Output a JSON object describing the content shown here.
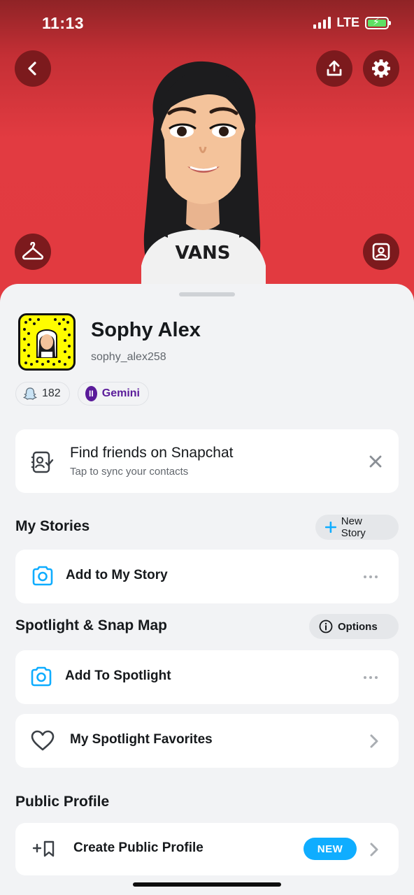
{
  "status_bar": {
    "time": "11:13",
    "network": "LTE"
  },
  "header": {
    "back_icon": "chevron-left-icon",
    "share_icon": "share-upload-icon",
    "settings_icon": "gear-icon",
    "wardrobe_icon": "hanger-icon",
    "selfie_icon": "image-icon",
    "avatar_shirt_text": "VANS",
    "accent_color": "#e23a40"
  },
  "profile": {
    "display_name": "Sophy Alex",
    "username": "sophy_alex258",
    "snap_score": "182",
    "zodiac_label": "Gemini"
  },
  "find_friends": {
    "title": "Find friends on Snapchat",
    "subtitle": "Tap to sync your contacts"
  },
  "my_stories": {
    "title": "My Stories",
    "new_story_label": "New Story",
    "add_label": "Add to My Story"
  },
  "spotlight": {
    "title": "Spotlight & Snap Map",
    "options_label": "Options",
    "add_label": "Add To Spotlight",
    "favorites_label": "My Spotlight Favorites"
  },
  "public_profile": {
    "title": "Public Profile",
    "create_label": "Create Public Profile",
    "badge": "NEW",
    "badge_color": "#0fadff"
  }
}
